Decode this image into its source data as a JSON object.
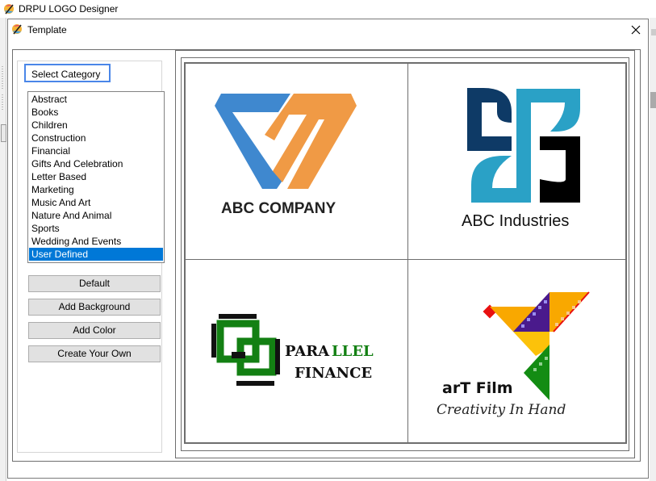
{
  "app": {
    "title": "DRPU LOGO Designer"
  },
  "dialog": {
    "title": "Template",
    "close_icon": "close-icon"
  },
  "category": {
    "legend": "Select Category",
    "items": [
      "Abstract",
      "Books",
      "Children",
      "Construction",
      "Financial",
      "Gifts And Celebration",
      "Letter Based",
      "Marketing",
      "Music And Art",
      "Nature And Animal",
      "Sports",
      "Wedding And Events",
      "User Defined"
    ],
    "selected": "User Defined",
    "selected_color": "#0078d7"
  },
  "buttons": {
    "default": "Default",
    "add_background": "Add Background",
    "add_color": "Add Color",
    "create_your_own": "Create Your Own"
  },
  "templates": [
    {
      "name": "ABC COMPANY",
      "colors": {
        "primary": "#3f88cf",
        "secondary": "#f09a45",
        "text": "#222222"
      }
    },
    {
      "name": "ABC Industries",
      "colors": {
        "dark": "#0e3a66",
        "light": "#2aa1c6",
        "black": "#000000",
        "text": "#111111"
      }
    },
    {
      "name_part1": "PARA",
      "name_part2": "LLEL",
      "name_line2": "FINANCE",
      "colors": {
        "green": "#138013",
        "black": "#111111"
      }
    },
    {
      "name": "arT Film",
      "tagline": "Creativity In Hand",
      "colors": {
        "orange": "#f9a800",
        "purple": "#4a1a8c",
        "green": "#138c13",
        "red": "#e81010",
        "yellow": "#fcc20a"
      }
    }
  ]
}
